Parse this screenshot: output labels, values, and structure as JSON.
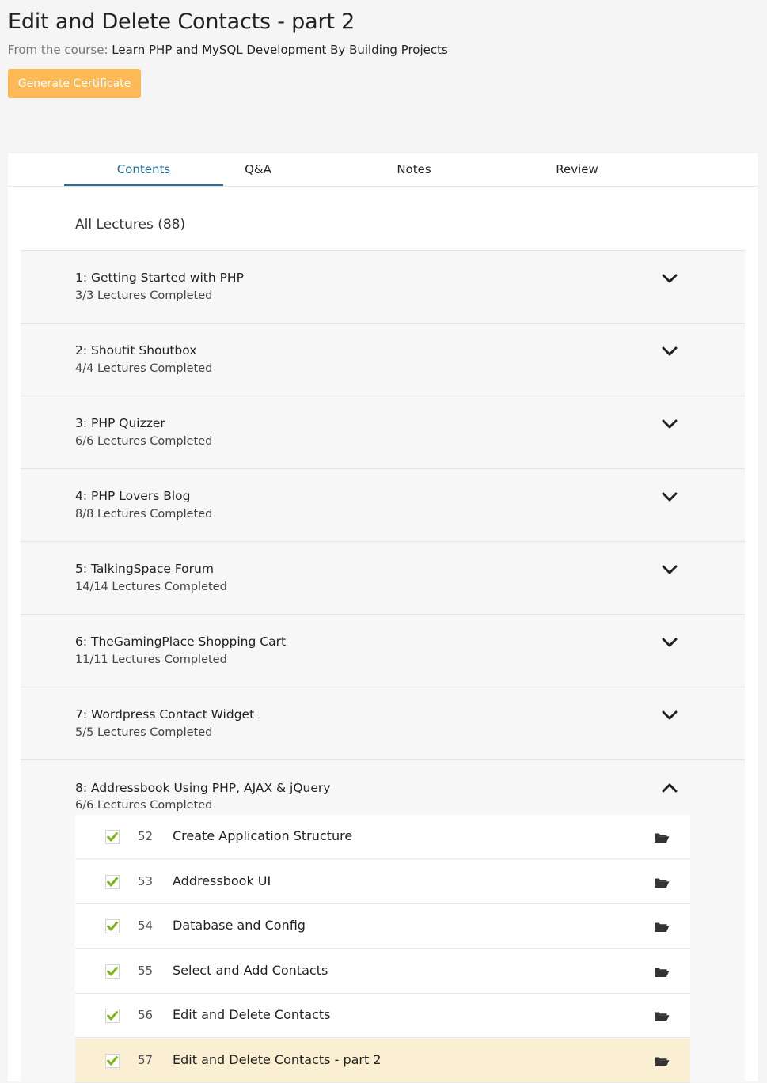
{
  "header": {
    "title": "Edit and Delete Contacts - part 2",
    "from_label": "From the course:",
    "course_name": "Learn PHP and MySQL Development By Building Projects",
    "certificate_button": "Generate Certificate"
  },
  "tabs": [
    "Contents",
    "Q&A",
    "Notes",
    "Review"
  ],
  "active_tab": "Contents",
  "all_lectures": "All Lectures (88)",
  "sections": [
    {
      "title": "1: Getting Started with PHP",
      "progress": "3/3 Lectures Completed",
      "expanded": false
    },
    {
      "title": "2: Shoutit Shoutbox",
      "progress": "4/4 Lectures Completed",
      "expanded": false
    },
    {
      "title": "3: PHP Quizzer",
      "progress": "6/6 Lectures Completed",
      "expanded": false
    },
    {
      "title": "4: PHP Lovers Blog",
      "progress": "8/8 Lectures Completed",
      "expanded": false
    },
    {
      "title": "5: TalkingSpace Forum",
      "progress": "14/14 Lectures Completed",
      "expanded": false
    },
    {
      "title": "6: TheGamingPlace Shopping Cart",
      "progress": "11/11 Lectures Completed",
      "expanded": false
    },
    {
      "title": "7: Wordpress Contact Widget",
      "progress": "5/5 Lectures Completed",
      "expanded": false
    },
    {
      "title": "8: Addressbook Using PHP, AJAX & jQuery",
      "progress": "6/6 Lectures Completed",
      "expanded": true
    }
  ],
  "lectures": [
    {
      "num": "52",
      "title": "Create Application Structure",
      "completed": true,
      "current": false
    },
    {
      "num": "53",
      "title": "Addressbook UI",
      "completed": true,
      "current": false
    },
    {
      "num": "54",
      "title": "Database and Config",
      "completed": true,
      "current": false
    },
    {
      "num": "55",
      "title": "Select and Add Contacts",
      "completed": true,
      "current": false
    },
    {
      "num": "56",
      "title": "Edit and Delete Contacts",
      "completed": true,
      "current": false
    },
    {
      "num": "57",
      "title": "Edit and Delete Contacts - part 2",
      "completed": true,
      "current": true
    }
  ],
  "icons": {
    "check": "checkmark-icon",
    "folder": "folder-icon",
    "chevron_collapsed": "chevron-down-icon",
    "chevron_expanded": "chevron-up-icon"
  },
  "colors": {
    "accent": "#1f6f9f",
    "button": "#fdb955",
    "check": "#7cb518",
    "current_row": "#faefd2"
  }
}
